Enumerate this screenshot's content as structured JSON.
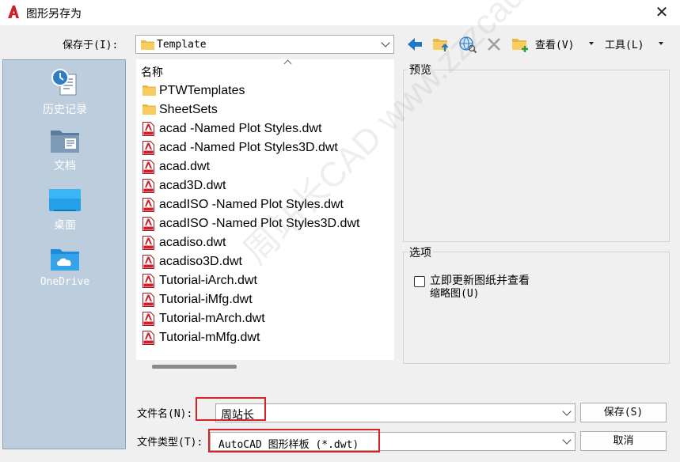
{
  "window": {
    "title": "图形另存为",
    "close_glyph": "✕"
  },
  "save_in": {
    "label": "保存于(I):",
    "value": "Template"
  },
  "toolbar": {
    "view_label": "查看(V)",
    "tools_label": "工具(L)"
  },
  "places": [
    {
      "label": "历史记录",
      "icon": "history-icon"
    },
    {
      "label": "文档",
      "icon": "documents-icon"
    },
    {
      "label": "桌面",
      "icon": "desktop-icon"
    },
    {
      "label": "OneDrive",
      "icon": "onedrive-icon"
    }
  ],
  "filelist": {
    "column_header": "名称",
    "files": [
      {
        "name": "PTWTemplates",
        "type": "folder"
      },
      {
        "name": "SheetSets",
        "type": "folder"
      },
      {
        "name": "acad -Named Plot Styles.dwt",
        "type": "dwt"
      },
      {
        "name": "acad -Named Plot Styles3D.dwt",
        "type": "dwt"
      },
      {
        "name": "acad.dwt",
        "type": "dwt"
      },
      {
        "name": "acad3D.dwt",
        "type": "dwt"
      },
      {
        "name": "acadISO -Named Plot Styles.dwt",
        "type": "dwt"
      },
      {
        "name": "acadISO -Named Plot Styles3D.dwt",
        "type": "dwt"
      },
      {
        "name": "acadiso.dwt",
        "type": "dwt"
      },
      {
        "name": "acadiso3D.dwt",
        "type": "dwt"
      },
      {
        "name": "Tutorial-iArch.dwt",
        "type": "dwt"
      },
      {
        "name": "Tutorial-iMfg.dwt",
        "type": "dwt"
      },
      {
        "name": "Tutorial-mArch.dwt",
        "type": "dwt"
      },
      {
        "name": "Tutorial-mMfg.dwt",
        "type": "dwt"
      }
    ]
  },
  "preview": {
    "title": "预览"
  },
  "options": {
    "title": "选项",
    "checkbox_label_line1": "立即更新图纸并查看",
    "checkbox_label_line2": "缩略图(U)",
    "checked": false
  },
  "filename": {
    "label": "文件名(N):",
    "value": "周站长"
  },
  "filetype": {
    "label": "文件类型(T):",
    "value": "AutoCAD 图形样板 (*.dwt)"
  },
  "buttons": {
    "save": "保存(S)",
    "cancel": "取消"
  },
  "watermark": "周站长CAD  www.zzzcad.com",
  "colors": {
    "places_bg": "#bccddd",
    "highlight_box": "#d9202b",
    "autocad_red": "#d01f2a"
  }
}
